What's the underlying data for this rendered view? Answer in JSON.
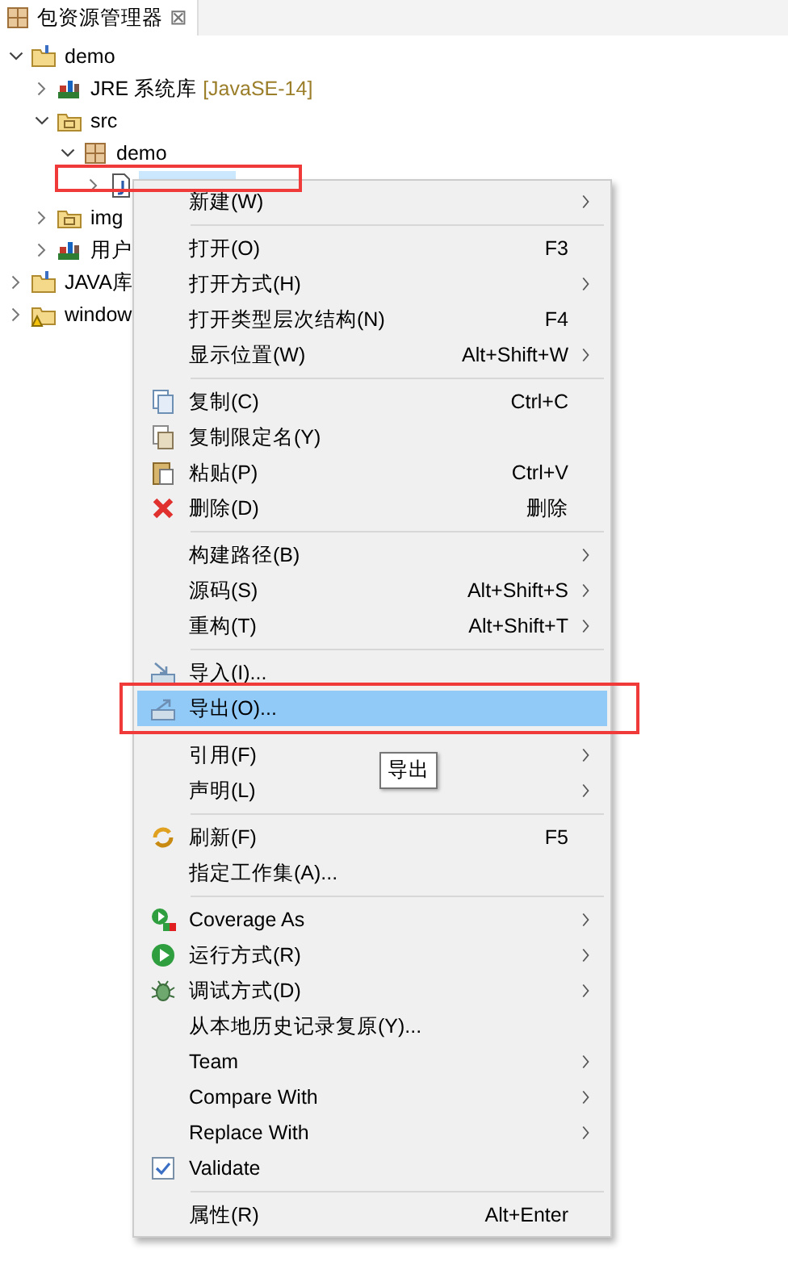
{
  "view_tab": {
    "title": "包资源管理器",
    "close": "⊠"
  },
  "tree": [
    {
      "label": "demo",
      "kind": "project",
      "expanded": true,
      "children": [
        {
          "label": "JRE 系统库",
          "suffix": "[JavaSE-14]",
          "kind": "library",
          "expanded": false
        },
        {
          "label": "src",
          "kind": "srcfolder",
          "expanded": true,
          "children": [
            {
              "label": "demo",
              "kind": "package",
              "expanded": true,
              "children": [
                {
                  "kind": "javafile",
                  "expanded": false,
                  "selected": true,
                  "outlined": true
                }
              ]
            }
          ]
        },
        {
          "label": "img",
          "kind": "srcfolder",
          "expanded": false
        },
        {
          "label": "用户",
          "kind": "library",
          "expanded": false
        }
      ]
    },
    {
      "label": "JAVA库",
      "kind": "project",
      "expanded": false
    },
    {
      "label": "window",
      "kind": "project-warning",
      "expanded": false
    }
  ],
  "context_menu": {
    "groups": [
      [
        {
          "label": "新建(W)",
          "submenu": true,
          "selected": false
        }
      ],
      [
        {
          "label": "打开(O)",
          "shortcut": "F3",
          "submenu": false,
          "selected": false
        },
        {
          "label": "打开方式(H)",
          "submenu": true,
          "selected": false
        },
        {
          "label": "打开类型层次结构(N)",
          "shortcut": "F4",
          "submenu": false,
          "selected": false
        },
        {
          "label": "显示位置(W)",
          "shortcut": "Alt+Shift+W",
          "submenu": true,
          "selected": false
        }
      ],
      [
        {
          "label": "复制(C)",
          "shortcut": "Ctrl+C",
          "kind": "copy",
          "submenu": false,
          "selected": false
        },
        {
          "label": "复制限定名(Y)",
          "kind": "copy-name",
          "submenu": false,
          "selected": false
        },
        {
          "label": "粘贴(P)",
          "shortcut": "Ctrl+V",
          "kind": "paste",
          "submenu": false,
          "selected": false
        },
        {
          "label": "删除(D)",
          "shortcut": "删除",
          "kind": "delete",
          "submenu": false,
          "selected": false
        }
      ],
      [
        {
          "label": "构建路径(B)",
          "submenu": true,
          "selected": false
        },
        {
          "label": "源码(S)",
          "shortcut": "Alt+Shift+S",
          "submenu": true,
          "selected": false
        },
        {
          "label": "重构(T)",
          "shortcut": "Alt+Shift+T",
          "submenu": true,
          "selected": false
        }
      ],
      [
        {
          "label": "导入(I)...",
          "kind": "import",
          "submenu": false,
          "selected": false
        },
        {
          "label": "导出(O)...",
          "kind": "export",
          "submenu": false,
          "selected": true,
          "outlined": true
        }
      ],
      [
        {
          "label": "引用(F)",
          "submenu": true,
          "selected": false
        },
        {
          "label": "声明(L)",
          "submenu": true,
          "selected": false
        }
      ],
      [
        {
          "label": "刷新(F)",
          "shortcut": "F5",
          "kind": "refresh",
          "submenu": false,
          "selected": false
        },
        {
          "label": "指定工作集(A)...",
          "submenu": false,
          "selected": false
        }
      ],
      [
        {
          "label": "Coverage As",
          "kind": "coverage",
          "submenu": true,
          "selected": false
        },
        {
          "label": "运行方式(R)",
          "kind": "run",
          "submenu": true,
          "selected": false
        },
        {
          "label": "调试方式(D)",
          "kind": "debug",
          "submenu": true,
          "selected": false
        },
        {
          "label": "从本地历史记录复原(Y)...",
          "submenu": false,
          "selected": false
        },
        {
          "label": "Team",
          "submenu": true,
          "selected": false
        },
        {
          "label": "Compare With",
          "submenu": true,
          "selected": false
        },
        {
          "label": "Replace With",
          "submenu": true,
          "selected": false
        },
        {
          "label": "Validate",
          "kind": "check",
          "submenu": false,
          "selected": false
        }
      ],
      [
        {
          "label": "属性(R)",
          "shortcut": "Alt+Enter",
          "submenu": false,
          "selected": false
        }
      ]
    ]
  },
  "tooltip": "导出"
}
